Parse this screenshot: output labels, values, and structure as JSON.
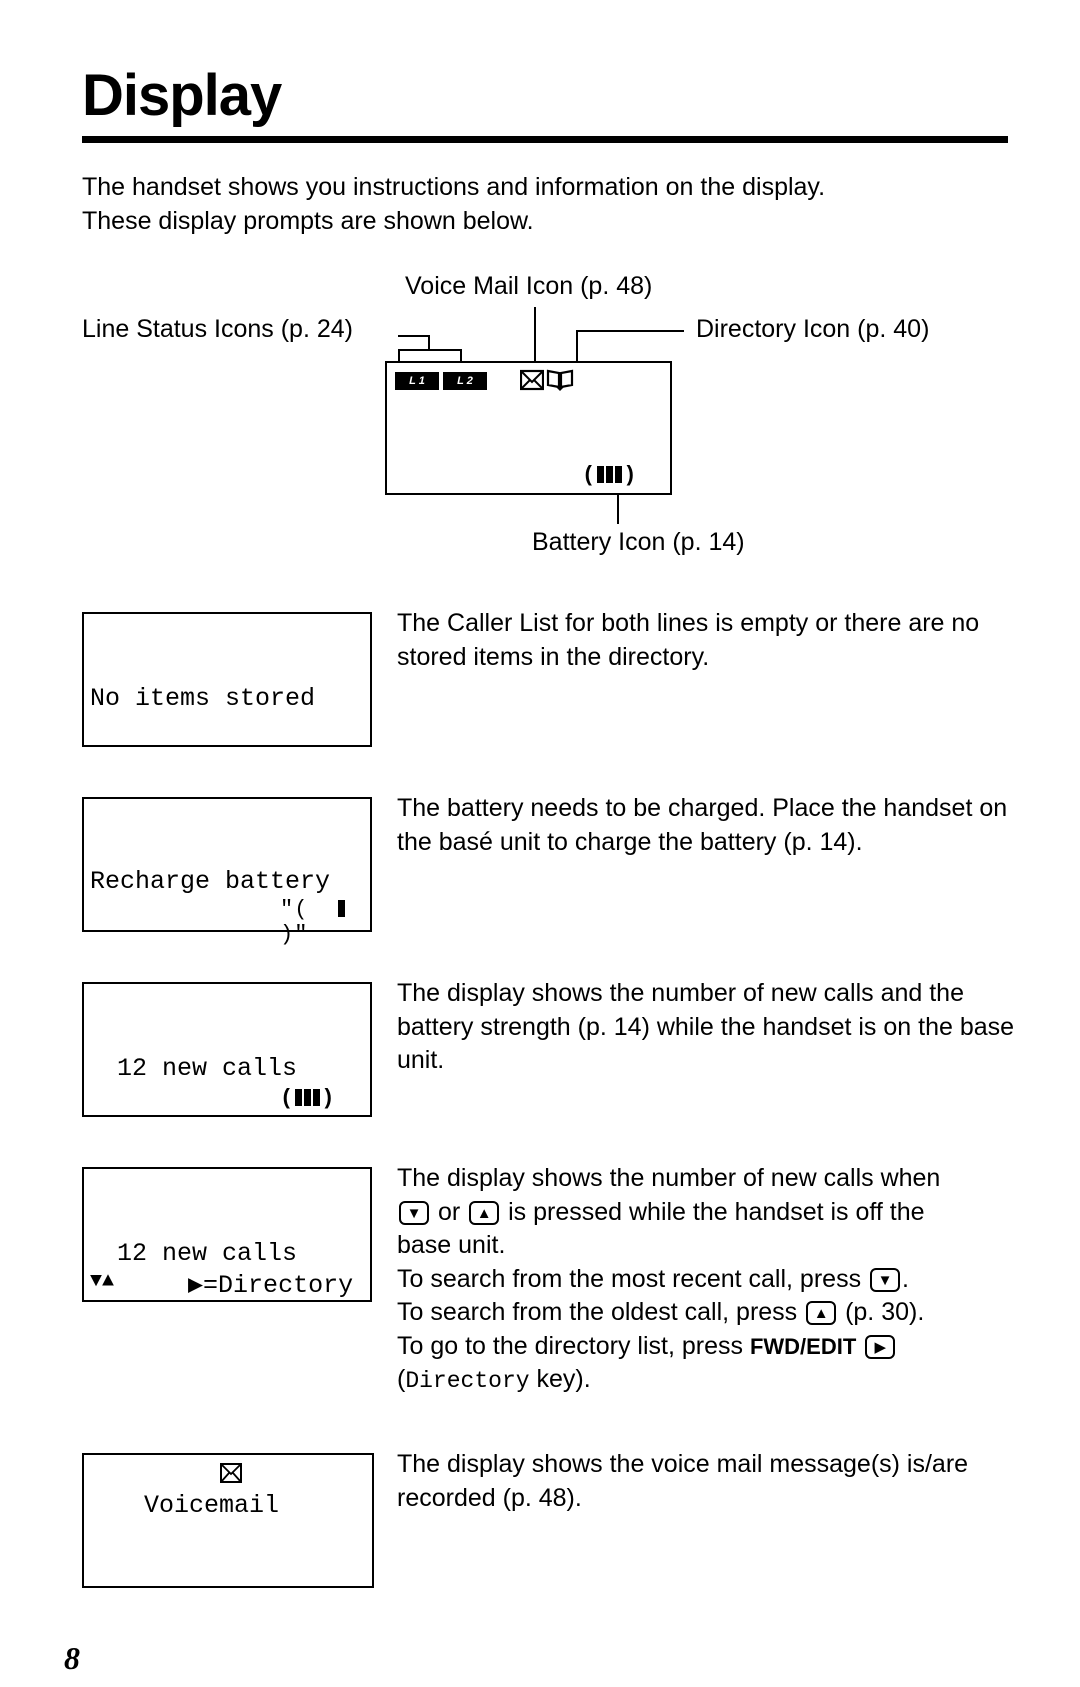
{
  "page": {
    "title": "Display",
    "intro_line1": "The handset shows you instructions and information on the display.",
    "intro_line2": "These display prompts are shown below.",
    "page_number": "8"
  },
  "diagram": {
    "voice_mail_label": "Voice Mail Icon (p. 48)",
    "line_status_label": "Line Status Icons (p. 24)",
    "directory_label": "Directory Icon (p. 40)",
    "battery_label": "Battery Icon (p. 14)",
    "line1_badge": "L 1",
    "line2_badge": "L 2",
    "icons": [
      "line1-status-icon",
      "line2-status-icon",
      "envelope-icon",
      "open-book-icon",
      "battery-full-icon"
    ]
  },
  "prompts": [
    {
      "screen_line1": "No items stored",
      "description": "The Caller List for both lines is empty or there are no stored items in the directory."
    },
    {
      "screen_line1": "Recharge battery",
      "screen_line2_icon": "battery-low-flashing-icon",
      "description": "The battery needs to be charged. Place the handset on the basé unit to charge the battery (p. 14)."
    },
    {
      "screen_line1": " 12 new calls",
      "screen_line2_icon": "battery-full-icon",
      "description": "The display shows the number of new calls and the battery strength (p. 14) while the handset is on the base unit."
    },
    {
      "screen_line1": " 12 new calls",
      "screen_line2_left": "▼▲",
      "screen_line2_right": "▶=Directory",
      "desc_p1_a": "The display shows the number of new calls when",
      "desc_p1_b": "or",
      "desc_p1_c": "is pressed while the handset is off the",
      "desc_p1_d": "base unit.",
      "desc_p2": "To search from the most recent call, press",
      "desc_p3_a": "To search from the oldest call, press",
      "desc_p3_b": "(p. 30).",
      "desc_p4_a": "To go to the directory list, press",
      "desc_p4_key": "FWD/EDIT",
      "desc_p5_mono": "Directory",
      "desc_p5_b": "key).",
      "key_down": "▼",
      "key_up": "▲",
      "key_right": "▶"
    },
    {
      "screen_line1": "Voicemail",
      "screen_icon": "envelope-icon",
      "description": "The display shows the voice mail message(s) is/are recorded (p. 48)."
    }
  ]
}
